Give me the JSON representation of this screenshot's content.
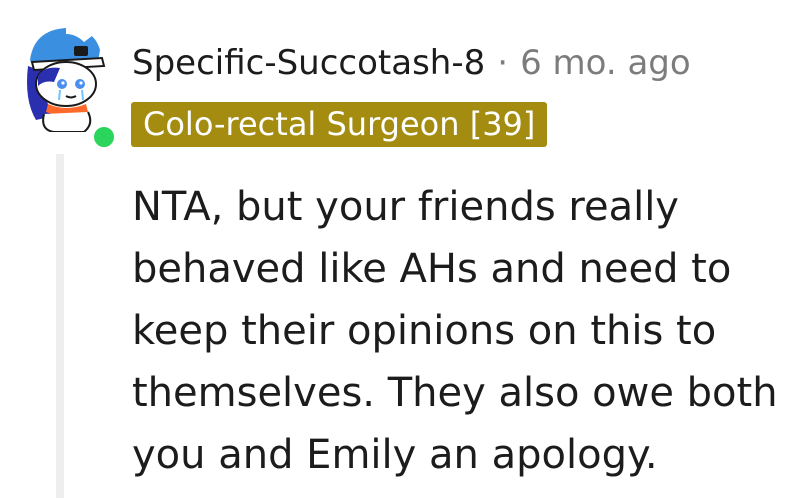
{
  "comment": {
    "author": "Specific-Succotash-8",
    "separator": "·",
    "timestamp": "6 mo. ago",
    "flair": "Colo-rectal Surgeon [39]",
    "body": "NTA, but your friends really behaved like AHs and need to keep their opinions on this to themselves. They also owe both you and Emily an apology.",
    "author_online": true
  },
  "colors": {
    "flair_background": "#a48c10",
    "online_indicator": "#2bd45b",
    "thread_line": "#eeeeee",
    "meta_text": "#7c7c7c"
  },
  "icons": {
    "avatar": "snoo-avatar-icon",
    "online": "online-status-icon"
  }
}
